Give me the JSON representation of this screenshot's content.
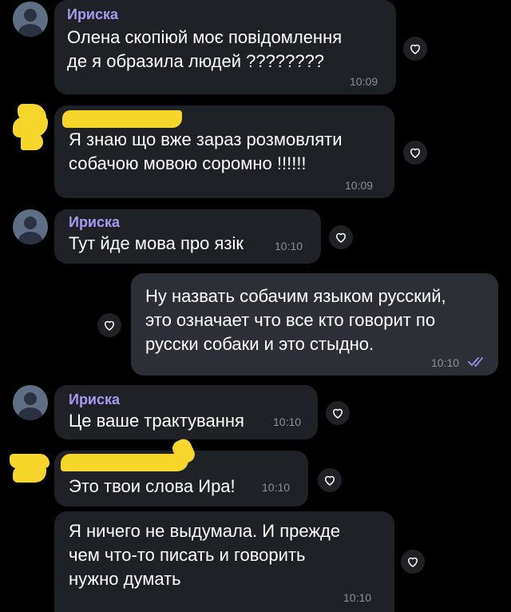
{
  "messages": [
    {
      "sender": "Ириска",
      "text": "Олена скопіюй моє повідомлення\nде я образила людей ????????",
      "time": "10:09"
    },
    {
      "sender": "",
      "text": "Я знаю що вже зараз розмовляти\nсобачою мовою соромно !!!!!!",
      "time": "10:09"
    },
    {
      "sender": "Ириска",
      "text": "Тут йде мова про язік",
      "time": "10:10"
    },
    {
      "sender": "",
      "text": "Ну назвать собачим языком русский,\nэто означает что все кто говорит по\nрусски собаки и это стыдно.",
      "time": "10:10"
    },
    {
      "sender": "Ириска",
      "text": "Це ваше трактування",
      "time": "10:10"
    },
    {
      "sender": "",
      "text": "Это твои слова Ира!",
      "time": "10:10"
    },
    {
      "sender": "",
      "text": "Я ничего не выдумала. И прежде\nчем что-то писать и говорить\nнужно думать",
      "time": "10:10"
    }
  ],
  "icons": {
    "reaction": "heart-icon",
    "read_status": "double-check-icon",
    "avatar": "person-icon"
  },
  "colors": {
    "background": "#000000",
    "bubble_incoming": "#1e2126",
    "bubble_outgoing": "#2c2f36",
    "sender_name": "#a79bf0",
    "redaction": "#f6d62a"
  }
}
